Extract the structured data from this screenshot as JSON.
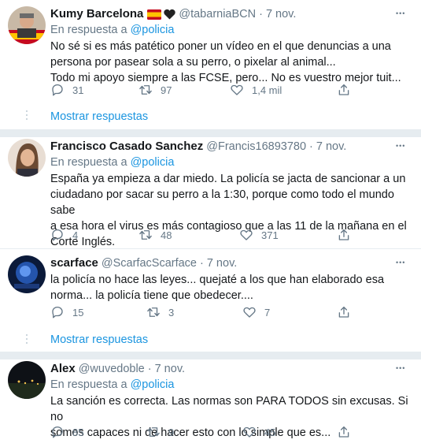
{
  "tweets": [
    {
      "name": "Kumy Barcelona",
      "handle": "@tabarniaBCN",
      "dot": "·",
      "date": "7 nov.",
      "reply_prefix": "En respuesta a",
      "reply_to": "@policia",
      "lines": [
        "No sé si es más patético poner un vídeo en el que denuncias a una",
        "persona por pasear sola a su perro, o pixelar al animal...",
        "Todo mi apoyo siempre a las FCSE, pero... No es vuestro mejor tuit..."
      ],
      "replies": "31",
      "retweets": "97",
      "likes": "1,4 mil"
    },
    {
      "name": "Francisco Casado Sanchez",
      "handle": "@Francis16893780",
      "dot": "·",
      "date": "7 nov.",
      "reply_prefix": "En respuesta a",
      "reply_to": "@policia",
      "lines": [
        "España ya empieza a dar miedo. La policía se jacta de sancionar a un",
        "ciudadano por sacar su perro a la 1:30, porque como todo el mundo sabe",
        "a esa hora el virus es más contagioso que a las 11 de la mañana en el",
        "Corte Inglés."
      ],
      "replies": "4",
      "retweets": "48",
      "likes": "371"
    },
    {
      "name": "scarface",
      "handle": "@ScarfacScarface",
      "dot": "·",
      "date": "7 nov.",
      "lines": [
        "la policía no hace las leyes... quejaté a los que han elaborado esa",
        "norma... la policía tiene que obedecer...."
      ],
      "replies": "15",
      "retweets": "3",
      "likes": "7"
    },
    {
      "name": "Alex",
      "handle": "@wuvedoble",
      "dot": "·",
      "date": "7 nov.",
      "reply_prefix": "En respuesta a",
      "reply_to": "@policia",
      "lines": [
        "La sanción es correcta. Las normas son PARA TODOS sin excusas. Si no",
        "somos capaces ni de hacer esto con lo simple que es..."
      ],
      "replies": "85",
      "retweets": "9",
      "likes": "45"
    }
  ],
  "show_replies_label": "Mostrar respuestas",
  "more_glyph": "•••",
  "colors": {
    "link": "#1b95e0",
    "muted": "#657786",
    "divider": "#e6ecf0"
  }
}
